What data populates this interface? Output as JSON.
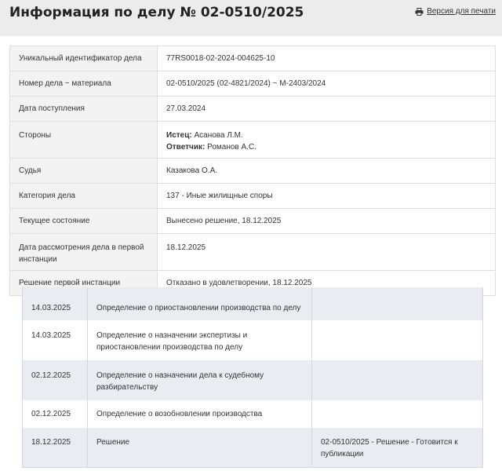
{
  "header": {
    "title": "Информация по делу № 02-0510/2025",
    "print_label": "Версия для печати"
  },
  "info": {
    "rows": [
      {
        "label": "Уникальный идентификатор дела",
        "value": "77RS0018-02-2024-004625-10"
      },
      {
        "label": "Номер дела ~ материала",
        "value": "02-0510/2025 (02-4821/2024) ~ М-2403/2024"
      },
      {
        "label": "Дата поступления",
        "value": "27.03.2024"
      },
      {
        "label": "Стороны",
        "plaintiff_label": "Истец:",
        "plaintiff": "Асанова Л.М.",
        "defendant_label": "Ответчик:",
        "defendant": "Романов А.С."
      },
      {
        "label": "Судья",
        "value": "Казакова О.А."
      },
      {
        "label": "Категория дела",
        "value": "137 - Иные жилищные споры"
      },
      {
        "label": "Текущее состояние",
        "value": "Вынесено решение, 18.12.2025"
      },
      {
        "label_line1": "Дата рассмотрения дела в первой",
        "label_line2": "инстанции",
        "value": "18.12.2025"
      },
      {
        "label": "Решение первой инстанции",
        "value": "Отказано в удовлетворении, 18.12.2025"
      }
    ]
  },
  "acts": {
    "rows": [
      {
        "date": "14.03.2025",
        "name_line1": "Определение о приостановлении производства по делу",
        "name_line2": "",
        "note_line1": "",
        "note_line2": ""
      },
      {
        "date": "14.03.2025",
        "name_line1": "Определение о назначении экспертизы и приостановлении",
        "name_line2": "производства по делу",
        "note_line1": "",
        "note_line2": ""
      },
      {
        "date": "02.12.2025",
        "name_line1": "Определение о назначении дела к судебному",
        "name_line2": "разбирательству",
        "note_line1": "",
        "note_line2": ""
      },
      {
        "date": "02.12.2025",
        "name_line1": "Определение о возобновлении производства",
        "name_line2": "",
        "note_line1": "",
        "note_line2": ""
      },
      {
        "date": "18.12.2025",
        "name_line1": "Решение",
        "name_line2": "",
        "note_line1": "02-0510/2025 - Решение - Готовится к",
        "note_line2": "публикации"
      }
    ]
  }
}
